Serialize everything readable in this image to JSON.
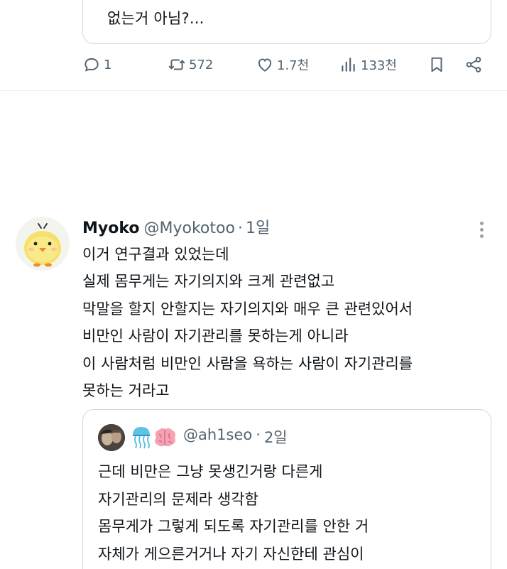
{
  "top_quote": {
    "text": "없는거 아님?..."
  },
  "actions": {
    "replies": "1",
    "retweets": "572",
    "likes": "1.7천",
    "views": "133천"
  },
  "tweet": {
    "display_name": "Myoko",
    "handle": "@Myokotoo",
    "separator": "·",
    "time": "1일",
    "lines": [
      "이거 연구결과 있었는데",
      "실제 몸무게는 자기의지와 크게 관련없고",
      "막말을 할지 안할지는 자기의지와 매우 큰 관련있어서",
      "비만인 사람이 자기관리를 못하는게 아니라",
      "이 사람처럼 비만인 사람을 욕하는 사람이 자기관리를",
      "못하는 거라고"
    ]
  },
  "quoted_tweet": {
    "handle": "@ah1seo",
    "separator": "·",
    "time": "2일",
    "lines": [
      "근데 비만은 그냥 못생긴거랑 다른게",
      "자기관리의 문제라 생각함",
      "몸무게가 그렇게 되도록 자기관리를 안한 거",
      "자체가 게으른거거나 자기 자신한테 관심이"
    ]
  },
  "colors": {
    "text_primary": "#0f1419",
    "text_secondary": "#536471",
    "border": "#cfd9de"
  }
}
